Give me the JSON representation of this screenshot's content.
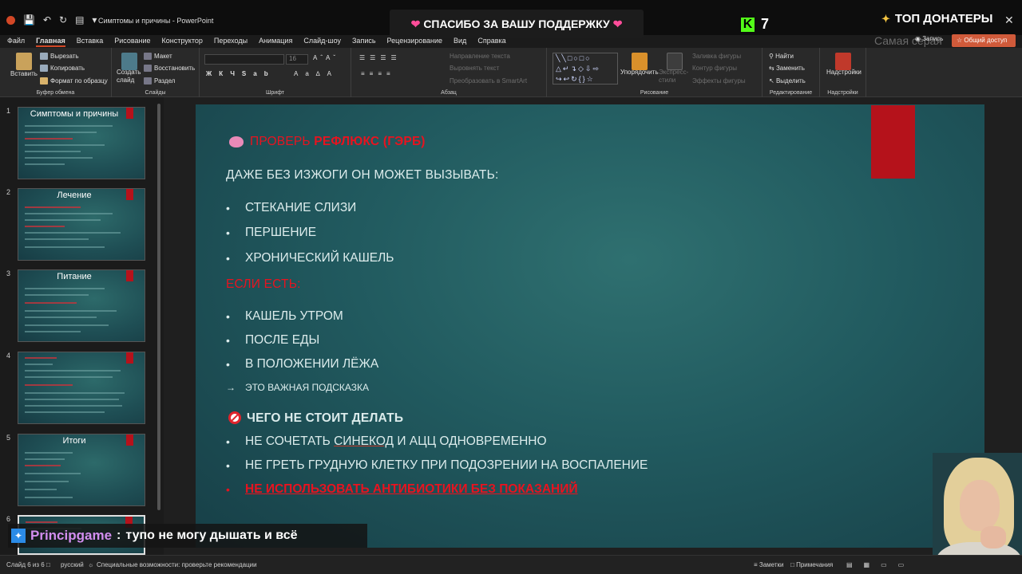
{
  "window": {
    "title": "Симптомы и причины - PowerPoint"
  },
  "overlay": {
    "thanks_banner": "СПАСИБО ЗА ВАШУ ПОДДЕРЖКУ",
    "kick_count": "7",
    "kick_letter": "K",
    "donors_title": "ТОП ДОНАТЕРЫ",
    "donor_ghost_text": "Самая серая",
    "chat_user": "Principgame",
    "chat_separator": " :",
    "chat_message": "тупо не могу дышать и всё"
  },
  "title_right": {
    "record_label": "Запись",
    "share_label": "Общий доступ"
  },
  "menu_tabs": [
    "Файл",
    "Главная",
    "Вставка",
    "Рисование",
    "Конструктор",
    "Переходы",
    "Анимация",
    "Слайд-шоу",
    "Запись",
    "Рецензирование",
    "Вид",
    "Справка"
  ],
  "ribbon": {
    "clipboard": {
      "paste": "Вставить",
      "cut": "Вырезать",
      "copy": "Копировать",
      "format_painter": "Формат по образцу",
      "label": "Буфер обмена"
    },
    "slides": {
      "new_slide": "Создать слайд",
      "layout": "Макет",
      "reset": "Восстановить",
      "section": "Раздел",
      "label": "Слайды"
    },
    "font": {
      "size": "16",
      "label": "Шрифт"
    },
    "paragraph": {
      "text_direction": "Направление текста",
      "align_text": "Выровнять текст",
      "convert_smartart": "Преобразовать в SmartArt",
      "label": "Абзац"
    },
    "drawing": {
      "arrange": "Упорядочить",
      "quick_styles": "Экспресс-стили",
      "shape_fill": "Заливка фигуры",
      "shape_outline": "Контур фигуры",
      "shape_effects": "Эффекты фигуры",
      "label": "Рисование"
    },
    "editing": {
      "find": "Найти",
      "replace": "Заменить",
      "select": "Выделить",
      "label": "Редактирование"
    },
    "addins": {
      "button": "Надстройки",
      "label": "Надстройки"
    }
  },
  "thumbnails": [
    {
      "num": "1",
      "title": "Симптомы и причины"
    },
    {
      "num": "2",
      "title": "Лечение"
    },
    {
      "num": "3",
      "title": "Питание"
    },
    {
      "num": "4",
      "title": ""
    },
    {
      "num": "5",
      "title": "Итоги"
    },
    {
      "num": "6",
      "title": ""
    }
  ],
  "slide": {
    "heading_prefix": "ПРОВЕРЬ ",
    "heading_bold": "РЕФЛЮКС (ГЭРБ)",
    "line_intro": "ДАЖЕ БЕЗ ИЗЖОГИ ОН МОЖЕТ ВЫЗЫВАТЬ:",
    "list1": [
      "СТЕКАНИЕ СЛИЗИ",
      "ПЕРШЕНИЕ",
      "ХРОНИЧЕСКИЙ КАШЕЛЬ"
    ],
    "if_label": "ЕСЛИ ЕСТЬ:",
    "list2": [
      "КАШЕЛЬ УТРОМ",
      "ПОСЛЕ ЕДЫ",
      "В ПОЛОЖЕНИИ ЛЁЖА"
    ],
    "hint": "ЭТО ВАЖНАЯ ПОДСКАЗКА",
    "dont_heading": "ЧЕГО НЕ СТОИТ ДЕЛАТЬ",
    "dont1_prefix": "НЕ СОЧЕТАТЬ ",
    "dont1_underlined": "СИНЕКОД",
    "dont1_suffix": " И АЦЦ ОДНОВРЕМЕННО",
    "dont2": "НЕ ГРЕТЬ ГРУДНУЮ КЛЕТКУ ПРИ ПОДОЗРЕНИИ НА ВОСПАЛЕНИЕ",
    "dont3": "НЕ ИСПОЛЬЗОВАТЬ АНТИБИОТИКИ БЕЗ ПОКАЗАНИЙ"
  },
  "status": {
    "slide_counter": "Слайд 6 из 6",
    "language": "русский",
    "accessibility": "Специальные возможности: проверьте рекомендации",
    "notes": "Заметки",
    "comments": "Примечания"
  },
  "colors": {
    "accent": "#d24726",
    "slide_red": "#b5121b",
    "slide_text": "#dcecec",
    "alert_red": "#e8131f"
  }
}
